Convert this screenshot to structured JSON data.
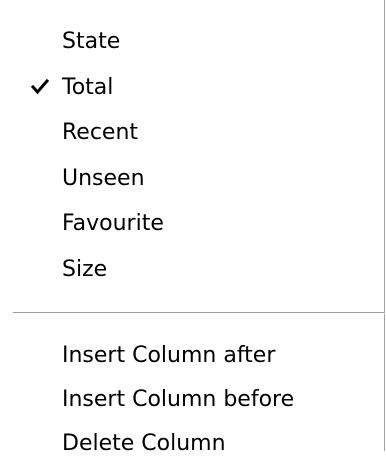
{
  "menu": {
    "columns": [
      {
        "label": "State",
        "checked": false
      },
      {
        "label": "Total",
        "checked": true
      },
      {
        "label": "Recent",
        "checked": false
      },
      {
        "label": "Unseen",
        "checked": false
      },
      {
        "label": "Favourite",
        "checked": false
      },
      {
        "label": "Size",
        "checked": false
      }
    ],
    "actions": [
      {
        "label": "Insert Column after"
      },
      {
        "label": "Insert Column before"
      },
      {
        "label": "Delete Column"
      }
    ]
  },
  "icons": {
    "check": "check-icon"
  }
}
